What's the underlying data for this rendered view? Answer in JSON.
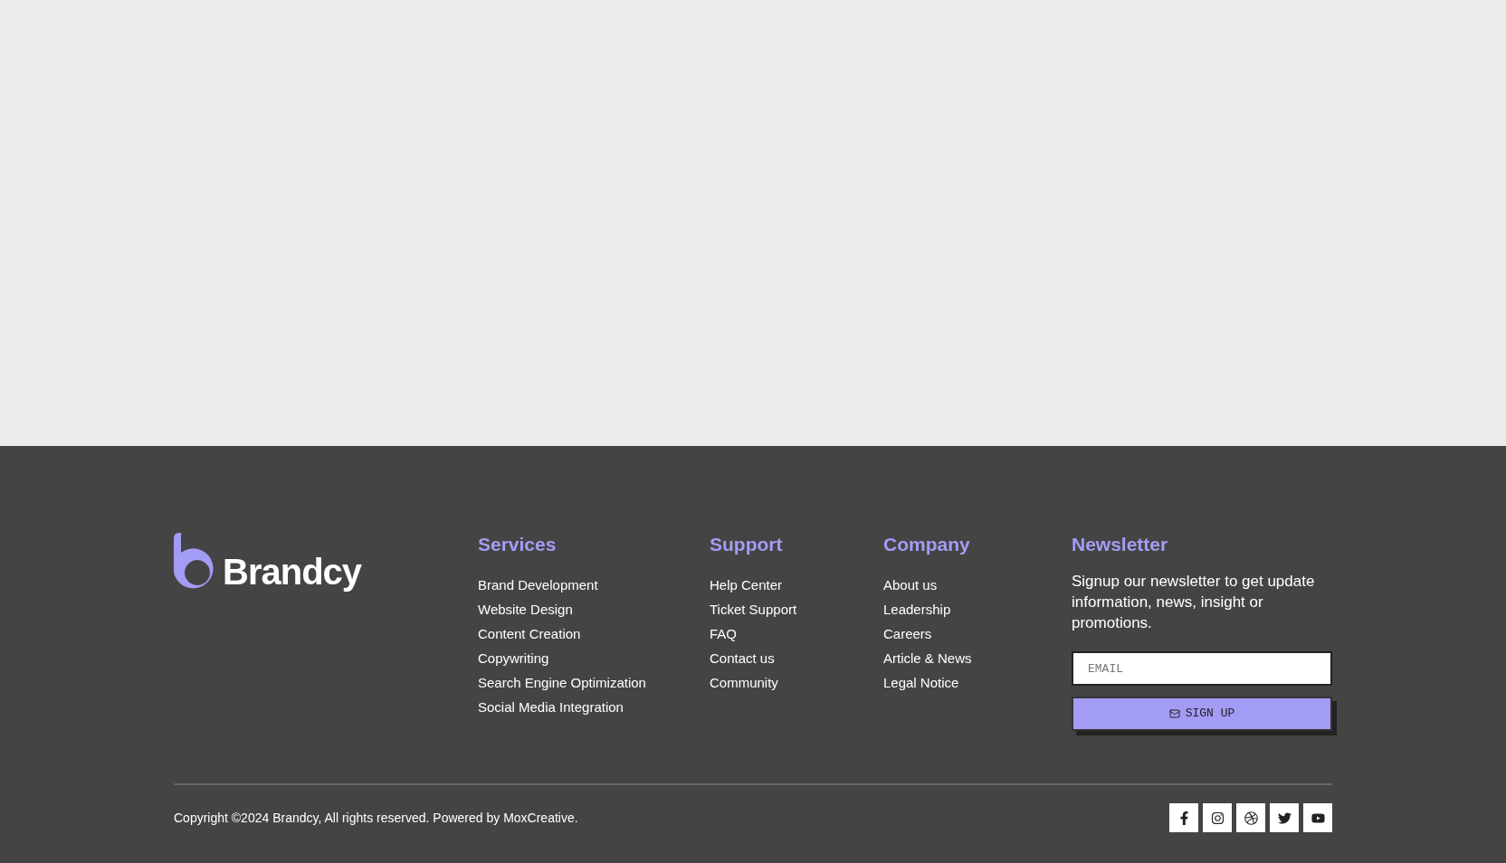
{
  "logo": {
    "text": "Brandcy"
  },
  "columns": [
    {
      "title": "Services",
      "links": [
        "Brand Development",
        "Website Design",
        "Content Creation",
        "Copywriting",
        "Search Engine Optimization",
        "Social Media Integration"
      ]
    },
    {
      "title": "Support",
      "links": [
        "Help Center",
        "Ticket Support",
        "FAQ",
        "Contact us",
        "Community"
      ]
    },
    {
      "title": "Company",
      "links": [
        "About us",
        "Leadership",
        "Careers",
        "Article & News",
        "Legal Notice"
      ]
    }
  ],
  "newsletter": {
    "title": "Newsletter",
    "text": "Signup our newsletter to get update information, news, insight or promotions.",
    "placeholder": "EMAIL",
    "button": "SIGN UP"
  },
  "copyright": {
    "text": "Copyright ©2024 Brandcy, All rights reserved. Powered by ",
    "link": "MoxCreative",
    "end": "."
  },
  "socials": [
    {
      "kind": "facebook"
    },
    {
      "kind": "instagram"
    },
    {
      "kind": "dribbble"
    },
    {
      "kind": "twitter"
    },
    {
      "kind": "youtube"
    }
  ]
}
